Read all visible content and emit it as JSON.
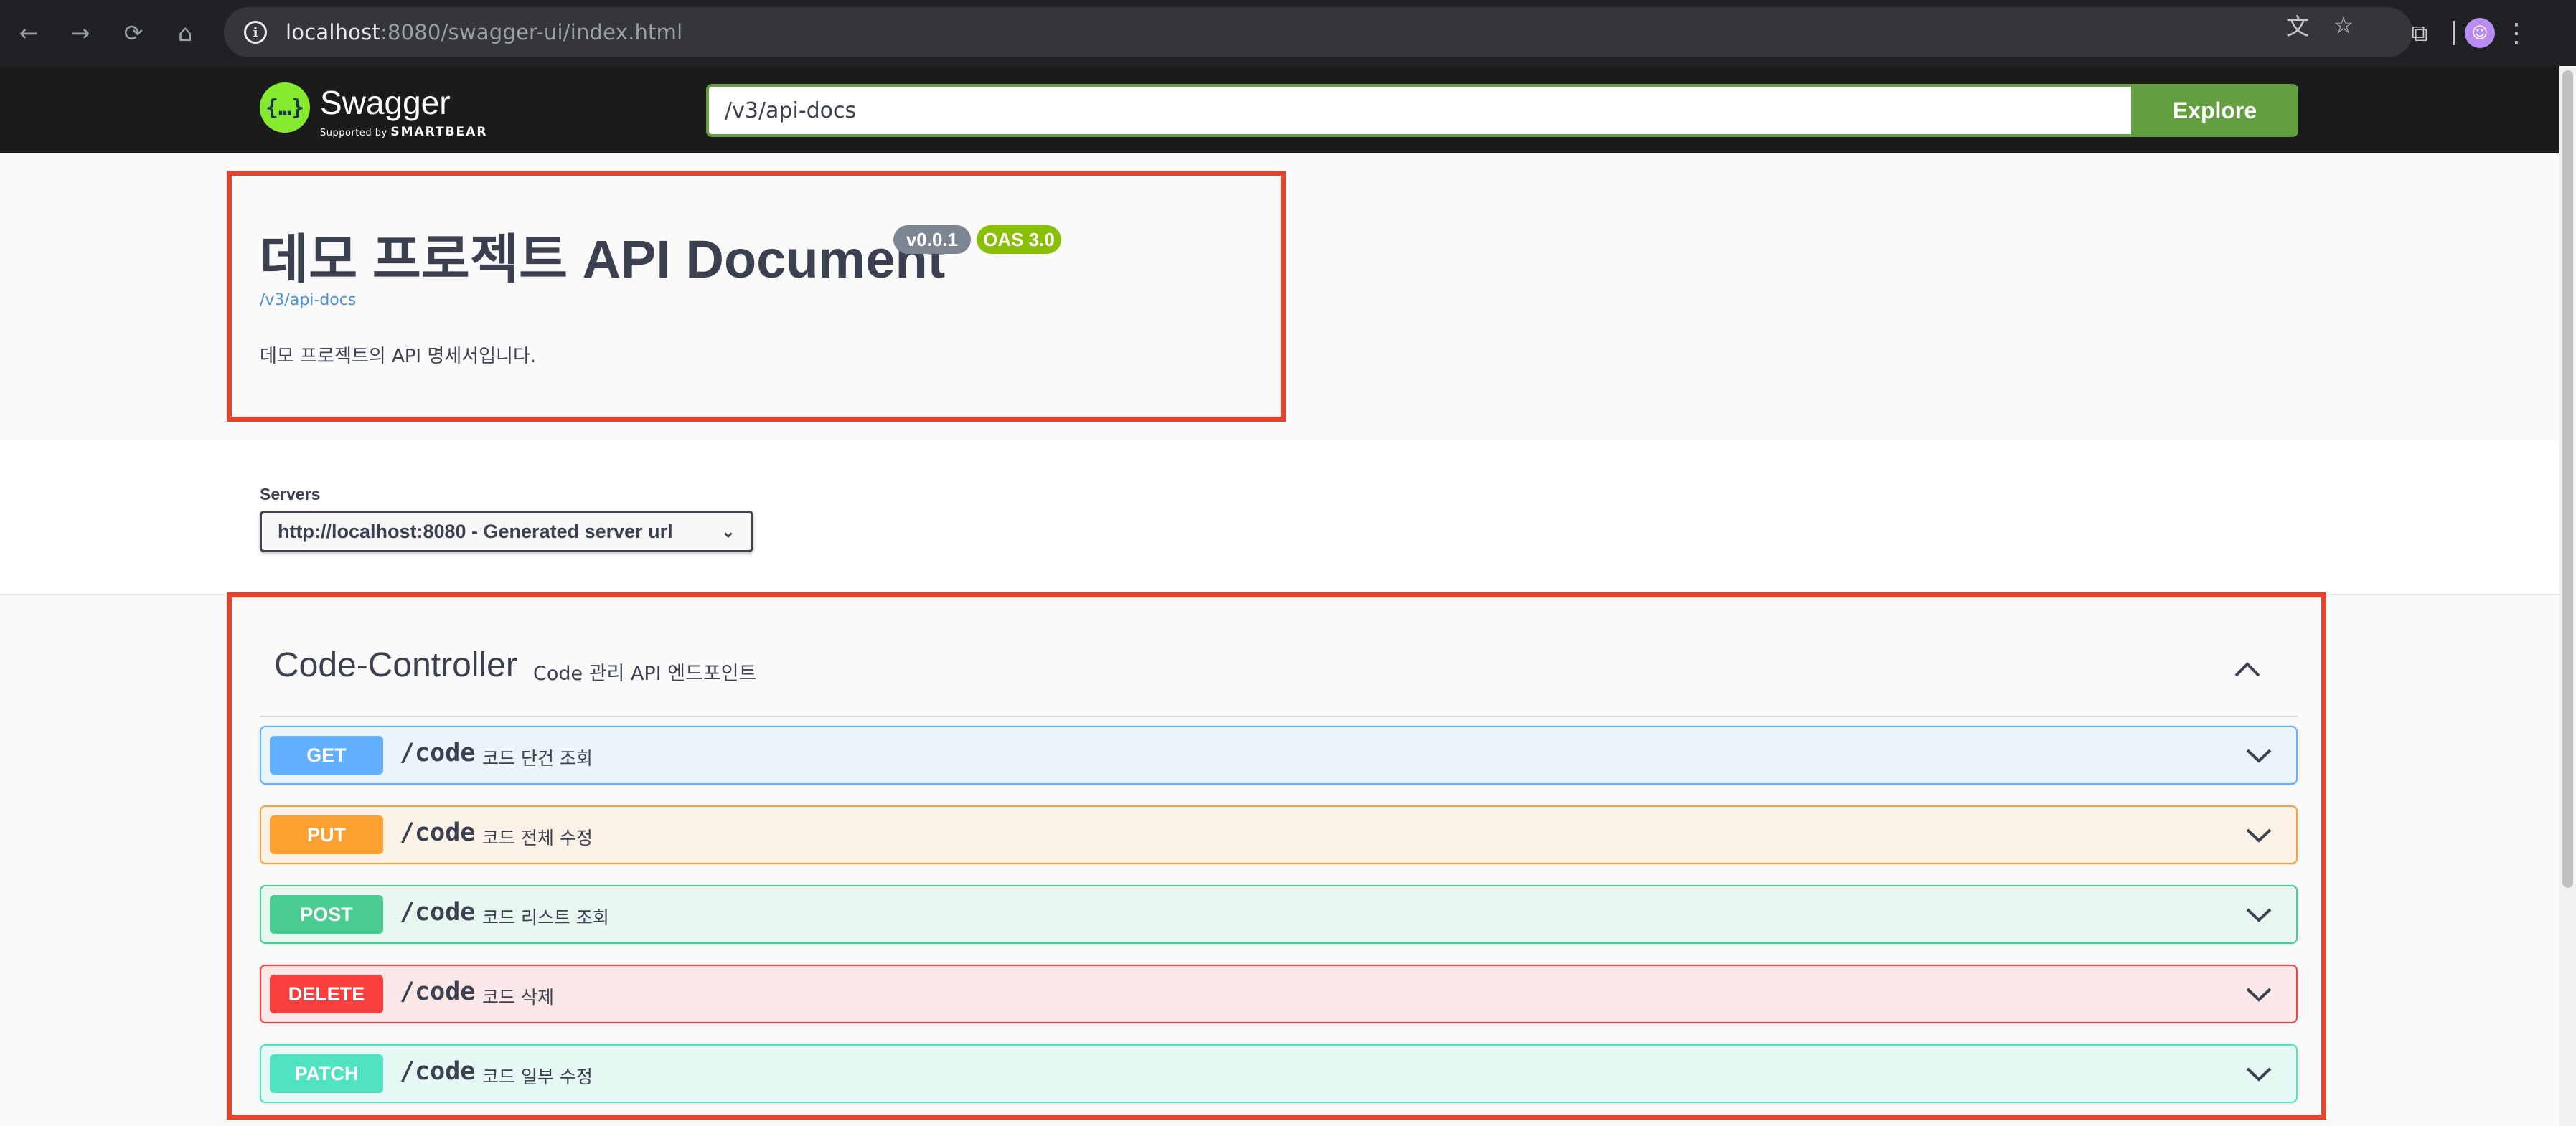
{
  "browser": {
    "url_host": "localhost",
    "url_rest": ":8080/swagger-ui/index.html",
    "avatar_glyph": "☺"
  },
  "topbar": {
    "logo_mark": "{…}",
    "logo_text": "Swagger",
    "logo_sub_prefix": "Supported by",
    "logo_sub_brand": "SMARTBEAR",
    "spec_url": "/v3/api-docs",
    "explore_label": "Explore"
  },
  "info": {
    "title": "데모 프로젝트 API Document",
    "version_badge": "v0.0.1",
    "oas_badge": "OAS 3.0",
    "spec_link": "/v3/api-docs",
    "description": "데모 프로젝트의 API 명세서입니다."
  },
  "servers": {
    "label": "Servers",
    "selected": "http://localhost:8080 - Generated server url"
  },
  "tag": {
    "name": "Code-Controller",
    "description": "Code 관리 API 엔드포인트"
  },
  "operations": [
    {
      "method": "GET",
      "path": "/code",
      "summary": "코드 단건 조회",
      "color": "#61affe",
      "bg": "#ebf3fb"
    },
    {
      "method": "PUT",
      "path": "/code",
      "summary": "코드 전체 수정",
      "color": "#fca130",
      "bg": "#fbf1e6"
    },
    {
      "method": "POST",
      "path": "/code",
      "summary": "코드 리스트 조회",
      "color": "#49cc90",
      "bg": "#e8f6f0"
    },
    {
      "method": "DELETE",
      "path": "/code",
      "summary": "코드 삭제",
      "color": "#f93e3e",
      "bg": "#fae7e7"
    },
    {
      "method": "PATCH",
      "path": "/code",
      "summary": "코드 일부 수정",
      "color": "#50e3c2",
      "bg": "#e5f8f4"
    }
  ],
  "colors": {
    "highlight_border": "#e8412c",
    "swagger_green": "#62a03f",
    "topbar_bg": "#1b1b1b"
  }
}
